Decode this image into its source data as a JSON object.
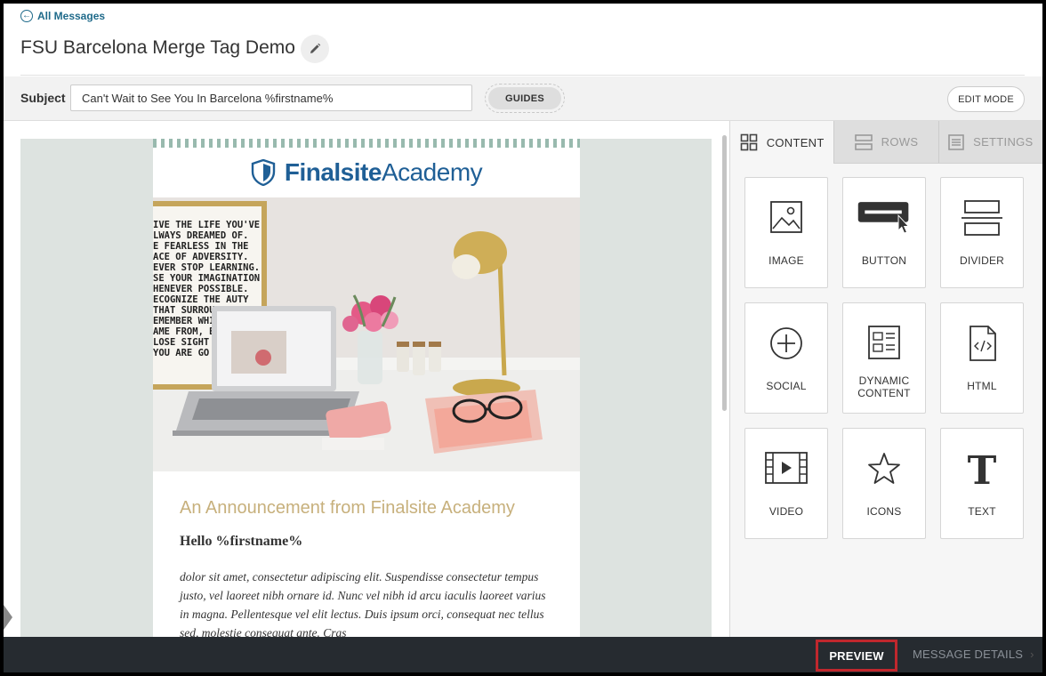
{
  "header": {
    "back_label": "All Messages",
    "title": "FSU Barcelona Merge Tag Demo"
  },
  "subject_bar": {
    "label": "Subject",
    "value": "Can't Wait to See You In Barcelona %firstname%",
    "guides_label": "GUIDES",
    "edit_mode_label": "EDIT MODE"
  },
  "email": {
    "logo_brand": "Finalsite",
    "logo_suffix": "Academy",
    "hero_poster_lines": [
      "IVE THE LIFE YOU'VE",
      "LWAYS DREAMED OF.",
      "E FEARLESS IN THE",
      "ACE OF ADVERSITY.",
      "EVER STOP LEARNING.",
      "SE YOUR IMAGINATION",
      "HENEVER POSSIBLE.",
      "ECOGNIZE THE   AUTY",
      "THAT SURROUN",
      "EMEMBER WHI",
      "AME FROM, BU",
      "LOSE SIGHT OF",
      "YOU ARE GO"
    ],
    "announcement_title": "An Announcement from Finalsite Academy",
    "greeting": "Hello %firstname%",
    "body": "dolor sit amet, consectetur adipiscing elit. Suspendisse consectetur tempus justo, vel laoreet nibh ornare id. Nunc vel nibh id arcu iaculis laoreet varius in magna. Pellentesque vel elit lectus. Duis ipsum orci, consequat nec tellus sed, molestie consequat ante. Cras"
  },
  "side_panel": {
    "tabs": [
      {
        "label": "CONTENT",
        "icon": "grid-icon",
        "active": true
      },
      {
        "label": "ROWS",
        "icon": "rows-icon",
        "active": false
      },
      {
        "label": "SETTINGS",
        "icon": "settings-icon",
        "active": false
      }
    ],
    "blocks": [
      {
        "label": "IMAGE",
        "icon": "image-icon"
      },
      {
        "label": "BUTTON",
        "icon": "button-icon"
      },
      {
        "label": "DIVIDER",
        "icon": "divider-icon"
      },
      {
        "label": "SOCIAL",
        "icon": "plus-circle-icon"
      },
      {
        "label": "DYNAMIC CONTENT",
        "icon": "dynamic-content-icon"
      },
      {
        "label": "HTML",
        "icon": "html-file-icon"
      },
      {
        "label": "VIDEO",
        "icon": "film-icon"
      },
      {
        "label": "ICONS",
        "icon": "star-icon"
      },
      {
        "label": "TEXT",
        "icon": "text-t-icon"
      }
    ]
  },
  "bottom_bar": {
    "preview_label": "PREVIEW",
    "details_label": "MESSAGE DETAILS"
  },
  "colors": {
    "link": "#1f6a8a",
    "logo_blue": "#1f5f96",
    "announcement_gold": "#c7b07c",
    "bottom_bar": "#262b30",
    "preview_outline": "#c0272d",
    "canvas_bg": "#dde3e0"
  }
}
